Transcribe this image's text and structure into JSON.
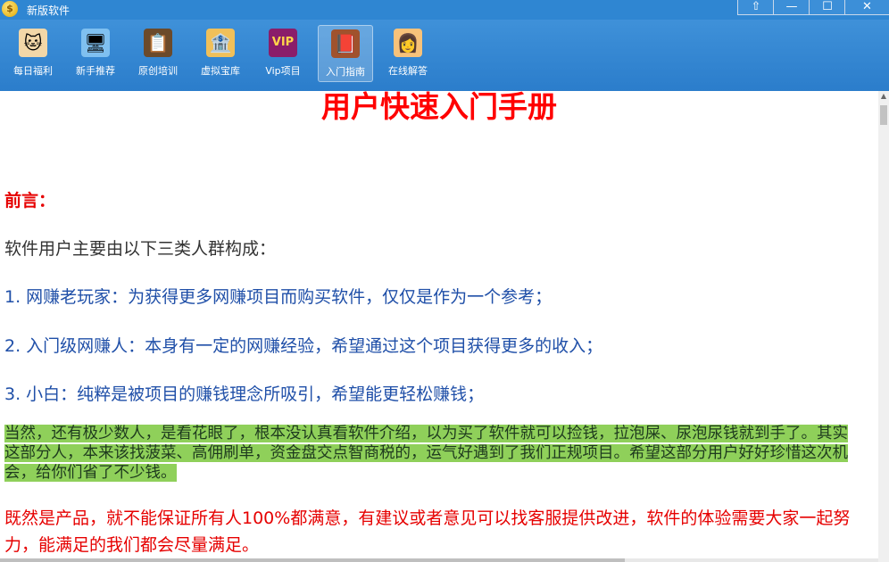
{
  "window": {
    "title": "新版软件",
    "controls": {
      "restore": "⇧",
      "minimize": "—",
      "maximize": "☐",
      "close": "✕"
    }
  },
  "toolbar": {
    "items": [
      {
        "label": "每日福利",
        "icon": "lucky-cat-icon",
        "glyph": "🐱",
        "color": "#f2d7a8"
      },
      {
        "label": "新手推荐",
        "icon": "monitor-icon",
        "glyph": "🖥",
        "color": "#7fc0f0"
      },
      {
        "label": "原创培训",
        "icon": "blackboard-icon",
        "glyph": "📋",
        "color": "#6b4a2b"
      },
      {
        "label": "虚拟宝库",
        "icon": "warehouse-icon",
        "glyph": "🏦",
        "color": "#f0c05a"
      },
      {
        "label": "Vip项目",
        "icon": "vip-icon",
        "glyph": "VIP",
        "color": "#8a1d6a"
      },
      {
        "label": "入门指南",
        "icon": "guide-book-icon",
        "glyph": "📕",
        "color": "#a0522d",
        "active": true
      },
      {
        "label": "在线解答",
        "icon": "support-agent-icon",
        "glyph": "👩",
        "color": "#f7c27a"
      }
    ]
  },
  "document": {
    "title": "用户快速入门手册",
    "preface": "前言：",
    "intro": "软件用户主要由以下三类人群构成：",
    "items": [
      "1. 网赚老玩家：为获得更多网赚项目而购买软件，仅仅是作为一个参考；",
      "2. 入门级网赚人：本身有一定的网赚经验，希望通过这个项目获得更多的收入；",
      "3. 小白：纯粹是被项目的赚钱理念所吸引，希望能更轻松赚钱；"
    ],
    "highlight": "当然，还有极少数人，是看花眼了，根本没认真看软件介绍，以为买了软件就可以捡钱，拉泡屎、尿泡尿钱就到手了。其实这部分人，本来该找菠菜、高佣刷单，资金盘交点智商税的，运气好遇到了我们正规项目。希望这部分用户好好珍惜这次机会，给你们省了不少钱。",
    "closing": "既然是产品，就不能保证所有人100%都满意，有建议或者意见可以找客服提供改进，软件的体验需要大家一起努力，能满足的我们都会尽量满足。"
  },
  "colors": {
    "titlebar": "#2f86d2",
    "toolbar": "#3f91d9",
    "title_red": "#ff0000",
    "item_blue": "#1f4fa8",
    "highlight_green": "#8fd05a"
  }
}
